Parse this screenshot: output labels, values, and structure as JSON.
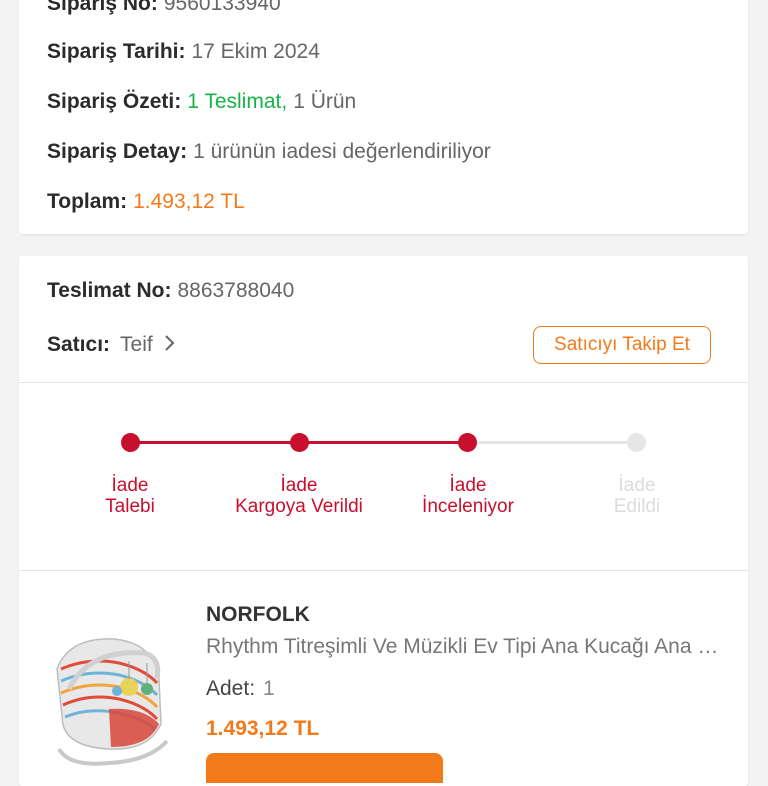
{
  "order": {
    "no_label": "Sipariş No:",
    "no_value": "9560133940",
    "date_label": "Sipariş Tarihi:",
    "date_value": "17 Ekim 2024",
    "summary_label": "Sipariş Özeti:",
    "summary_delivery": "1 Teslimat,",
    "summary_items": "1 Ürün",
    "detail_label": "Sipariş Detay:",
    "detail_value": "1 ürünün iadesi değerlendiriliyor",
    "total_label": "Toplam:",
    "total_value": "1.493,12 TL"
  },
  "delivery": {
    "no_label": "Teslimat No:",
    "no_value": "8863788040",
    "seller_label": "Satıcı:",
    "seller_value": "Teif",
    "follow_button": "Satıcıyı Takip Et"
  },
  "return_steps": [
    {
      "line1": "İade",
      "line2": "Talebi",
      "done": true
    },
    {
      "line1": "İade",
      "line2": "Kargoya Verildi",
      "done": true
    },
    {
      "line1": "İade",
      "line2": "İnceleniyor",
      "done": true
    },
    {
      "line1": "İade",
      "line2": "Edildi",
      "done": false
    }
  ],
  "product": {
    "brand": "NORFOLK",
    "name": "Rhythm Titreşimli Ve Müzikli Ev Tipi Ana Kucağı Ana Kucağı",
    "qty_label": "Adet:",
    "qty_value": "1",
    "price": "1.493,12 TL"
  },
  "colors": {
    "accent": "#f27a1a",
    "progress_active": "#c8102e",
    "progress_inactive": "#e6e6e6",
    "success": "#17b34a"
  }
}
